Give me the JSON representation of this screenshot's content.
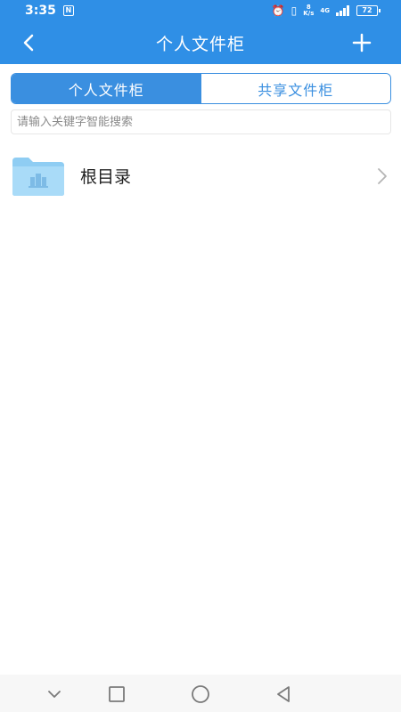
{
  "status_bar": {
    "time": "3:35",
    "net_speed_top": "8",
    "net_speed_bottom": "K/s",
    "signal_label": "4G",
    "battery": "72"
  },
  "header": {
    "title": "个人文件柜"
  },
  "tabs": [
    {
      "label": "个人文件柜",
      "active": true
    },
    {
      "label": "共享文件柜",
      "active": false
    }
  ],
  "search": {
    "value": "",
    "placeholder": "请输入关键字智能搜索"
  },
  "folders": [
    {
      "label": "根目录",
      "icon": "folder-icon"
    }
  ],
  "colors": {
    "primary": "#2f8fe6",
    "tab_active": "#3a8fe0",
    "folder": "#8fcdf3"
  }
}
